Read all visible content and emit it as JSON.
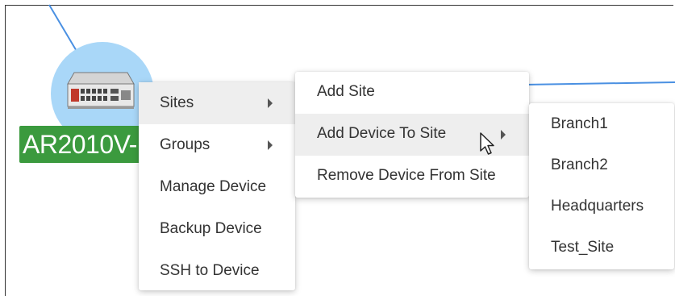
{
  "device": {
    "label": "AR2010V-",
    "icon": "router-icon",
    "circle_color": "#a9d7f8",
    "label_color": "#3b9a3e"
  },
  "context_menu": {
    "items": [
      {
        "label": "Sites",
        "has_submenu": true
      },
      {
        "label": "Groups",
        "has_submenu": true
      },
      {
        "label": "Manage Device",
        "has_submenu": false
      },
      {
        "label": "Backup Device",
        "has_submenu": false
      },
      {
        "label": "SSH to Device",
        "has_submenu": false
      }
    ]
  },
  "sites_submenu": {
    "items": [
      {
        "label": "Add Site",
        "has_submenu": false
      },
      {
        "label": "Add Device To Site",
        "has_submenu": true
      },
      {
        "label": "Remove Device From Site",
        "has_submenu": false
      }
    ]
  },
  "site_list_submenu": {
    "items": [
      {
        "label": "Branch1"
      },
      {
        "label": "Branch2"
      },
      {
        "label": "Headquarters"
      },
      {
        "label": "Test_Site"
      }
    ]
  },
  "colors": {
    "link_line": "#4a90e2",
    "menu_hover": "#eeeeee"
  }
}
